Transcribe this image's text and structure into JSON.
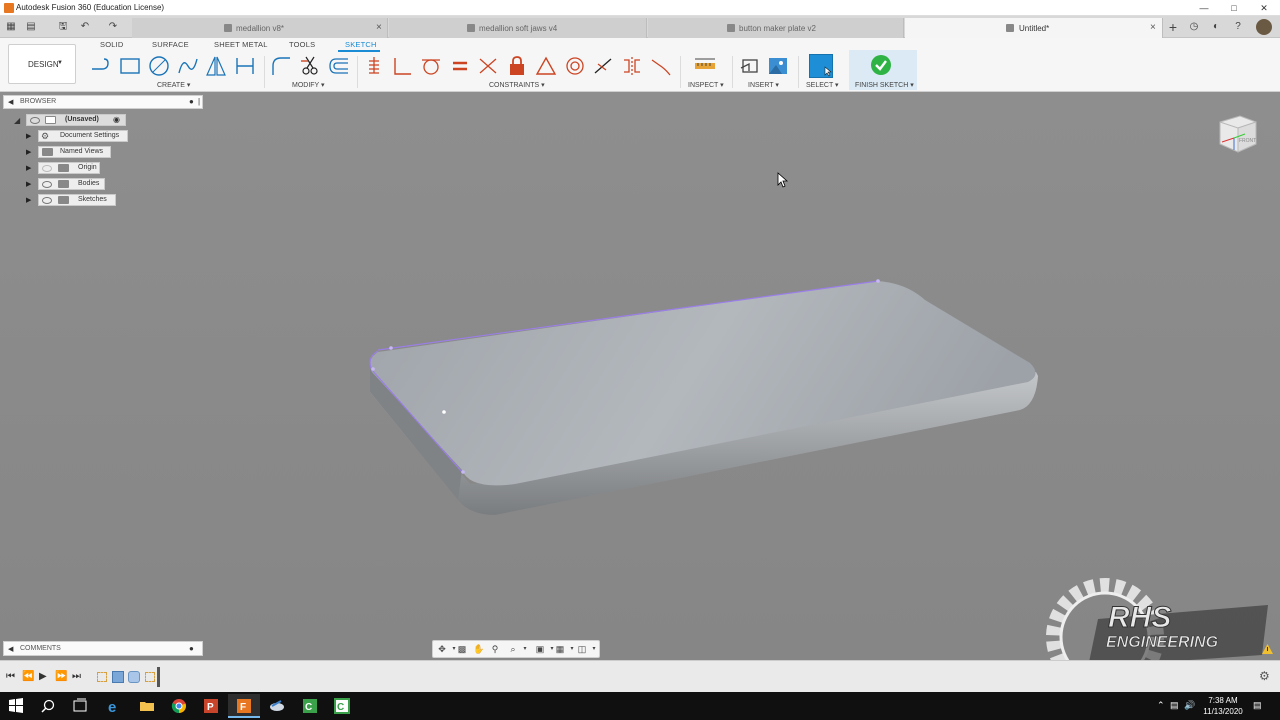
{
  "window": {
    "title": "Autodesk Fusion 360 (Education License)"
  },
  "tabs": [
    {
      "label": "medallion v8*",
      "active": false
    },
    {
      "label": "medallion soft jaws v4",
      "active": false
    },
    {
      "label": "button maker plate v2",
      "active": false
    },
    {
      "label": "Untitled*",
      "active": true
    }
  ],
  "toolbar": {
    "workspace": "DESIGN",
    "workspace_tabs": [
      "SOLID",
      "SURFACE",
      "SHEET METAL",
      "TOOLS",
      "SKETCH"
    ],
    "active_tab": "SKETCH",
    "groups": {
      "create": "CREATE",
      "modify": "MODIFY",
      "constraints": "CONSTRAINTS",
      "inspect": "INSPECT",
      "insert": "INSERT",
      "select": "SELECT",
      "finish": "FINISH SKETCH"
    },
    "accent": "#1a8bd5"
  },
  "browser": {
    "title": "BROWSER",
    "root": "(Unsaved)",
    "items": [
      "Document Settings",
      "Named Views",
      "Origin",
      "Bodies",
      "Sketches"
    ]
  },
  "comments": {
    "title": "COMMENTS"
  },
  "taskbar": {
    "time": "7:38 AM",
    "date": "11/13/2020"
  },
  "watermark": {
    "line1": "RHS",
    "line2": "ENGINEERING"
  },
  "navcube": {
    "face": "FRONT"
  }
}
